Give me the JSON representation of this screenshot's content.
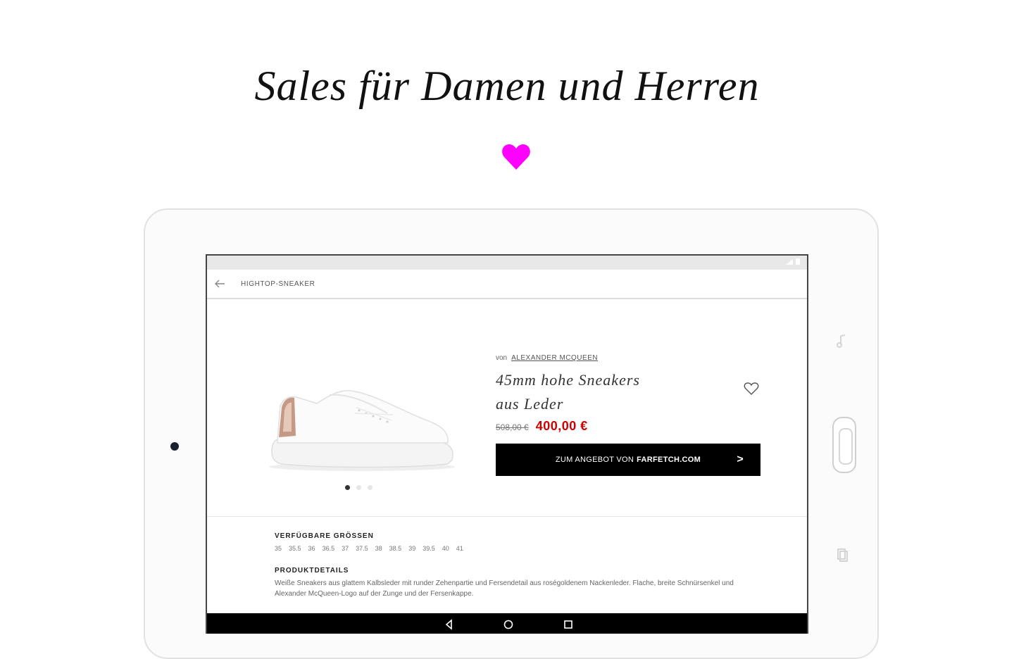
{
  "headline": "Sales für Damen und Herren",
  "colors": {
    "heart": "#ff00ff",
    "price": "#d10000",
    "button_bg": "#000000"
  },
  "icons": {
    "headline_heart": "heart-icon",
    "favorite": "heart-outline-icon",
    "back": "back-arrow-icon",
    "nav_back": "triangle-back-icon",
    "nav_home": "circle-home-icon",
    "nav_recent": "square-recent-icon"
  },
  "app": {
    "title": "HIGHTOP-SNEAKER"
  },
  "product": {
    "by_label": "von",
    "brand": "ALEXANDER MCQUEEN",
    "title_line1": "45mm hohe Sneakers",
    "title_line2": "aus Leder",
    "old_price": "508,00 €",
    "new_price": "400,00 €",
    "offer_button": {
      "prefix": "ZUM ANGEBOT VON",
      "site": "FARFETCH.COM",
      "chevron": ">"
    },
    "image_count": 3,
    "active_image": 1
  },
  "sizes": {
    "title": "VERFÜGBARE GRÖSSEN",
    "list": [
      "35",
      "35.5",
      "36",
      "36.5",
      "37",
      "37.5",
      "38",
      "38.5",
      "39",
      "39.5",
      "40",
      "41"
    ]
  },
  "details": {
    "title": "PRODUKTDETAILS",
    "text": "Weiße Sneakers aus glattem Kalbsleder mit runder Zehenpartie und Fersendetail aus roségoldenem Nackenleder. Flache, breite Schnürsenkel und Alexander McQueen-Logo auf der Zunge und der Fersenkappe."
  }
}
